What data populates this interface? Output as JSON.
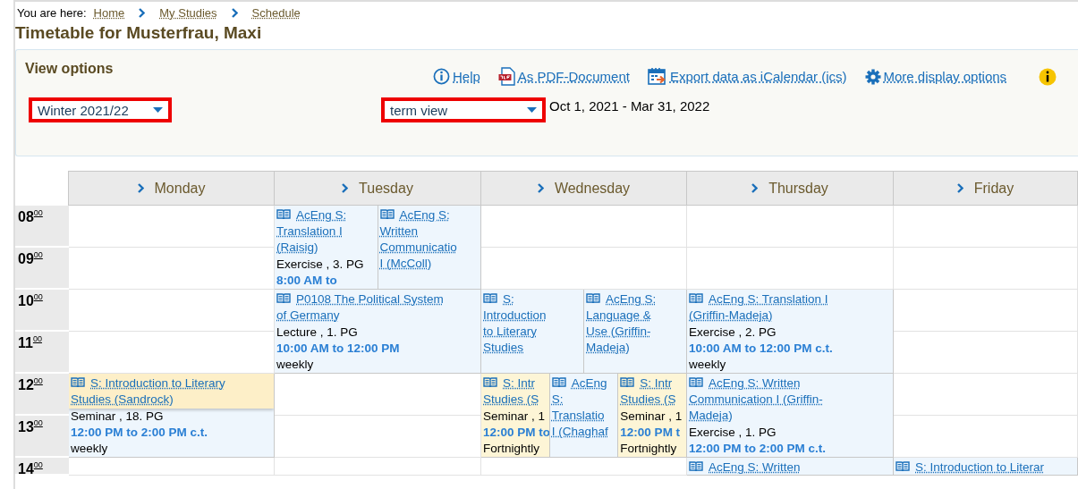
{
  "breadcrumb": {
    "prefix": "You are here:",
    "items": [
      "Home",
      "My Studies",
      "Schedule"
    ]
  },
  "title": "Timetable for Musterfrau, Maxi",
  "view_options": {
    "heading": "View options",
    "links": [
      {
        "kind": "help",
        "label": "Help"
      },
      {
        "kind": "pdf",
        "label": "As PDF-Document"
      },
      {
        "kind": "calendar",
        "label": "Export data as iCalendar (ics)"
      },
      {
        "kind": "settings",
        "label": "More display options"
      },
      {
        "kind": "info"
      }
    ],
    "term_select": {
      "value": "Winter 2021/22"
    },
    "view_select": {
      "value": "term view"
    },
    "date_range": "Oct 1, 2021 - Mar 31, 2022"
  },
  "timetable": {
    "hours": [
      "08$^{00}$",
      "09$^{00}$",
      "10$^{00}$",
      "11$^{00}$",
      "12$^{00}$",
      "13$^{00}$",
      "14$^{00}$"
    ],
    "days": [
      {
        "name": "Monday",
        "cells": [
          {
            "kind": "empty"
          },
          {
            "kind": "empty"
          },
          {
            "kind": "empty"
          },
          {
            "kind": "empty"
          },
          {
            "kind": "double",
            "events": [
              {
                "highlighted": false,
                "title_highlighted": true,
                "title_lines": [
                  "S: Introduction to Literary",
                  "Studies (Sandrock)"
                ],
                "type": "Seminar , 18. PG",
                "time": "12:00 PM to 2:00 PM c.t.",
                "frequency": "weekly"
              }
            ]
          },
          {
            "kind": "empty"
          }
        ]
      },
      {
        "name": "Tuesday",
        "cells": [
          {
            "kind": "double",
            "events": [
              {
                "highlighted": false,
                "title_highlighted": false,
                "title_lines": [
                  "AcEng S:",
                  "Translation I",
                  "(Raisig)"
                ],
                "type": "Exercise , 3. PG",
                "time": "8:00 AM to"
              },
              {
                "highlighted": false,
                "title_highlighted": false,
                "title_lines": [
                  "AcEng S:",
                  "Written",
                  "Communicatio",
                  "I (McColl)"
                ]
              }
            ]
          },
          {
            "kind": "double",
            "events": [
              {
                "highlighted": false,
                "title_highlighted": false,
                "title_lines": [
                  "P0108 The Political System",
                  "of Germany"
                ],
                "type": "Lecture , 1. PG",
                "time": "10:00 AM to 12:00 PM",
                "frequency": "weekly"
              }
            ]
          },
          {
            "kind": "empty"
          },
          {
            "kind": "empty"
          },
          {
            "kind": "empty"
          }
        ]
      },
      {
        "name": "Wednesday",
        "cells": [
          {
            "kind": "empty"
          },
          {
            "kind": "empty"
          },
          {
            "kind": "double",
            "events": [
              {
                "highlighted": false,
                "title_highlighted": false,
                "title_lines": [
                  "S:",
                  "Introduction",
                  "to Literary",
                  "Studies"
                ]
              },
              {
                "highlighted": false,
                "title_highlighted": false,
                "title_lines": [
                  "AcEng S:",
                  "Language &",
                  "Use (Griffin-",
                  "Madeja)"
                ]
              }
            ]
          },
          {
            "kind": "double",
            "events": [
              {
                "highlighted": true,
                "title_highlighted": false,
                "title_lines": [
                  "S: Intr",
                  "Studies (S"
                ],
                "type": "Seminar , 1",
                "time": "12:00 PM to",
                "frequency": "Fortnightly"
              },
              {
                "highlighted": false,
                "title_highlighted": false,
                "title_lines": [
                  "AcEng",
                  "S:",
                  "Translatio",
                  "I (Chaghaf"
                ]
              },
              {
                "highlighted": true,
                "title_highlighted": false,
                "title_lines": [
                  "S: Intr",
                  "Studies (S"
                ],
                "type": "Seminar , 1",
                "time": "12:00 PM t",
                "frequency": "Fortnightly"
              }
            ]
          },
          {
            "kind": "empty"
          }
        ]
      },
      {
        "name": "Thursday",
        "cells": [
          {
            "kind": "empty"
          },
          {
            "kind": "empty"
          },
          {
            "kind": "double",
            "events": [
              {
                "highlighted": false,
                "title_highlighted": false,
                "title_lines": [
                  "AcEng S: Translation I",
                  "(Griffin-Madeja)"
                ],
                "type": "Exercise , 2. PG",
                "time": "10:00 AM to 12:00 PM c.t.",
                "frequency": "weekly"
              }
            ]
          },
          {
            "kind": "double",
            "events": [
              {
                "highlighted": false,
                "title_highlighted": false,
                "title_lines": [
                  "AcEng S: Written",
                  "Communication I (Griffin-",
                  "Madeja)"
                ],
                "type": "Exercise , 1. PG",
                "time": "12:00 PM to 2:00 PM c.t."
              }
            ]
          },
          {
            "kind": "single",
            "events": [
              {
                "highlighted": false,
                "title_highlighted": false,
                "title_lines": [
                  "AcEng S: Written"
                ]
              }
            ]
          }
        ]
      },
      {
        "name": "Friday",
        "cells": [
          {
            "kind": "empty"
          },
          {
            "kind": "empty"
          },
          {
            "kind": "empty"
          },
          {
            "kind": "empty"
          },
          {
            "kind": "empty"
          },
          {
            "kind": "empty"
          },
          {
            "kind": "single",
            "events": [
              {
                "highlighted": false,
                "title_highlighted": false,
                "title_lines": [
                  "S: Introduction to Literar"
                ]
              }
            ]
          }
        ]
      }
    ]
  }
}
